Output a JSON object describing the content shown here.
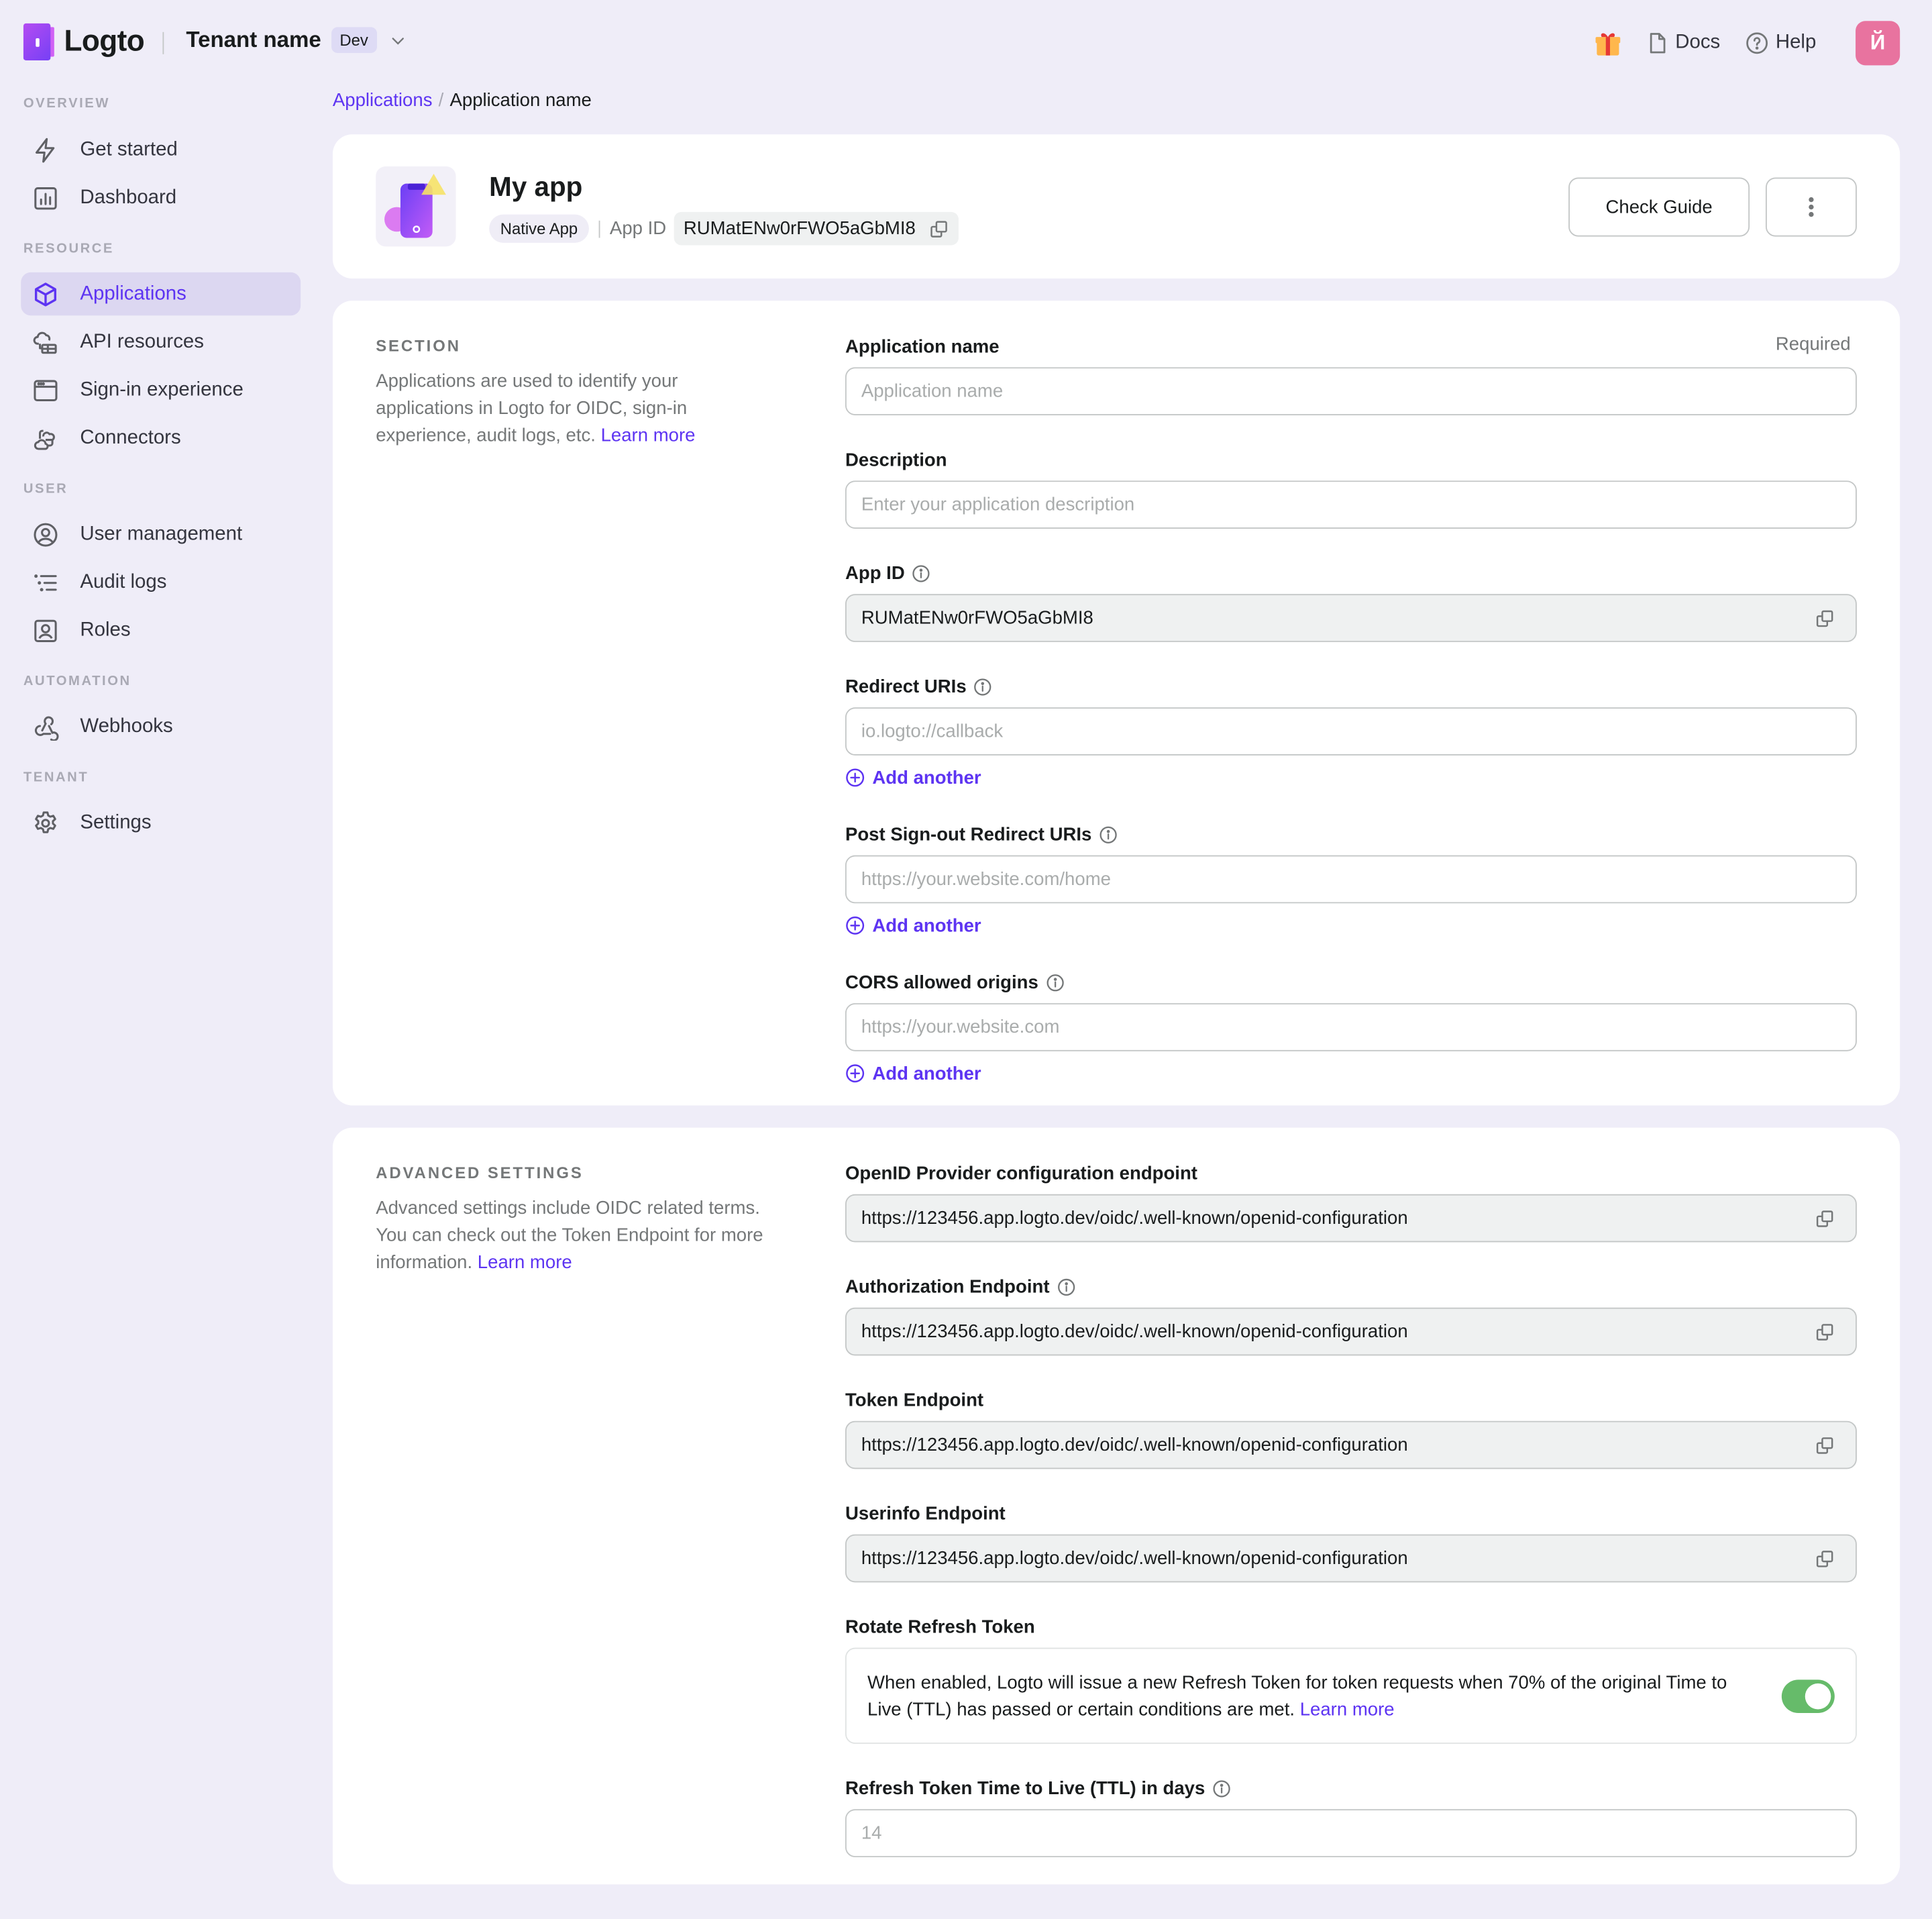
{
  "topbar": {
    "logo_text": "Logto",
    "tenant_name": "Tenant name",
    "tenant_tag": "Dev",
    "docs_label": "Docs",
    "help_label": "Help",
    "avatar_initial": "Й",
    "avatar_color": "#e8739f"
  },
  "sidebar": {
    "groups": [
      {
        "title": "OVERVIEW",
        "items": [
          {
            "label": "Get started",
            "icon": "lightning-icon"
          },
          {
            "label": "Dashboard",
            "icon": "bar-chart-icon"
          }
        ]
      },
      {
        "title": "RESOURCE",
        "items": [
          {
            "label": "Applications",
            "icon": "cube-icon",
            "active": true
          },
          {
            "label": "API resources",
            "icon": "cloud-api-icon"
          },
          {
            "label": "Sign-in experience",
            "icon": "browser-window-icon"
          },
          {
            "label": "Connectors",
            "icon": "connectors-icon"
          }
        ]
      },
      {
        "title": "USER",
        "items": [
          {
            "label": "User management",
            "icon": "user-circle-icon"
          },
          {
            "label": "Audit logs",
            "icon": "list-icon"
          },
          {
            "label": "Roles",
            "icon": "user-square-icon"
          }
        ]
      },
      {
        "title": "AUTOMATION",
        "items": [
          {
            "label": "Webhooks",
            "icon": "webhook-icon"
          }
        ]
      },
      {
        "title": "TENANT",
        "items": [
          {
            "label": "Settings",
            "icon": "gear-icon"
          }
        ]
      }
    ]
  },
  "breadcrumb": {
    "parent": "Applications",
    "separator": "/",
    "current": "Application name"
  },
  "app_header": {
    "title": "My app",
    "type_tag": "Native App",
    "app_id_label": "App ID",
    "app_id": "RUMatENw0rFWO5aGbMI8",
    "check_guide_label": "Check Guide"
  },
  "settings_section": {
    "title": "SECTION",
    "description": "Applications are used to identify your applications in Logto for OIDC, sign-in experience, audit logs, etc. ",
    "learn_more": "Learn more",
    "fields": {
      "app_name": {
        "label": "Application name",
        "required": "Required",
        "placeholder": "Application name",
        "value": ""
      },
      "description": {
        "label": "Description",
        "placeholder": "Enter your application description",
        "value": ""
      },
      "app_id": {
        "label": "App ID",
        "value": "RUMatENw0rFWO5aGbMI8"
      },
      "redirect_uris": {
        "label": "Redirect URIs",
        "placeholder": "io.logto://callback",
        "add_label": "Add another"
      },
      "post_signout_uris": {
        "label": "Post Sign-out Redirect URIs",
        "placeholder": "https://your.website.com/home",
        "add_label": "Add another"
      },
      "cors_origins": {
        "label": "CORS allowed origins",
        "placeholder": "https://your.website.com",
        "add_label": "Add another"
      }
    }
  },
  "advanced_section": {
    "title": "ADVANCED SETTINGS",
    "description": "Advanced settings include OIDC related terms. You can check out the Token Endpoint for more information. ",
    "learn_more": "Learn more",
    "fields": {
      "openid_config": {
        "label": "OpenID Provider configuration endpoint",
        "value": "https://123456.app.logto.dev/oidc/.well-known/openid-configuration"
      },
      "authorization": {
        "label": "Authorization Endpoint",
        "value": "https://123456.app.logto.dev/oidc/.well-known/openid-configuration"
      },
      "token": {
        "label": "Token Endpoint",
        "value": "https://123456.app.logto.dev/oidc/.well-known/openid-configuration"
      },
      "userinfo": {
        "label": "Userinfo Endpoint",
        "value": "https://123456.app.logto.dev/oidc/.well-known/openid-configuration"
      },
      "rotate_refresh": {
        "label": "Rotate Refresh Token",
        "description": "When enabled, Logto will issue a new Refresh Token for token requests when 70% of the original Time to Live (TTL) has passed or certain conditions are met. ",
        "learn_more": "Learn more",
        "enabled": true,
        "toggle_color": "#66bb6a"
      },
      "refresh_ttl": {
        "label": "Refresh Token Time to Live (TTL) in days",
        "placeholder": "14",
        "value": ""
      }
    }
  },
  "colors": {
    "accent": "#5d34f2",
    "background": "#efedf8"
  }
}
